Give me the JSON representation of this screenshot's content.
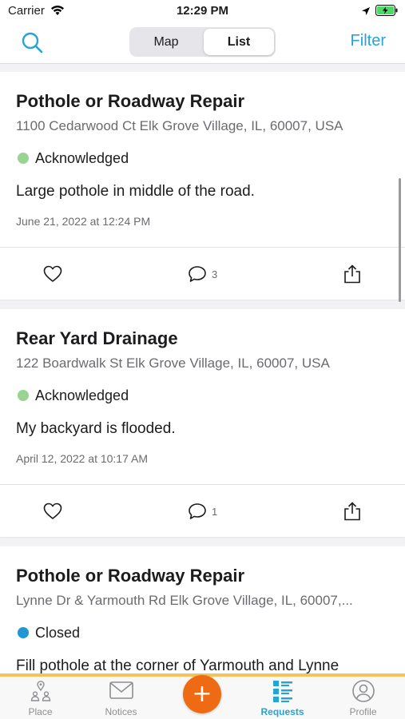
{
  "status_bar": {
    "carrier": "Carrier",
    "time": "12:29 PM"
  },
  "nav": {
    "segments": {
      "map": "Map",
      "list": "List"
    },
    "selected_segment": "List",
    "filter_label": "Filter",
    "accent_color": "#27a3d4"
  },
  "requests": [
    {
      "title": "Pothole or Roadway Repair",
      "address": "1100 Cedarwood Ct Elk Grove Village, IL, 60007, USA",
      "status": "Acknowledged",
      "status_color": "#99d493",
      "description": "Large pothole in middle of the road.",
      "date": "June 21, 2022 at 12:24 PM",
      "comment_count": "3"
    },
    {
      "title": "Rear Yard Drainage",
      "address": "122 Boardwalk St Elk Grove Village, IL, 60007, USA",
      "status": "Acknowledged",
      "status_color": "#99d493",
      "description": "My backyard is flooded.",
      "date": "April 12, 2022 at 10:17 AM",
      "comment_count": "1"
    },
    {
      "title": "Pothole or Roadway Repair",
      "address": "Lynne Dr & Yarmouth Rd Elk Grove Village, IL, 60007,...",
      "status": "Closed",
      "status_color": "#1e97d4",
      "description": "Fill pothole at the corner of Yarmouth and Lynne",
      "date": "",
      "comment_count": ""
    }
  ],
  "tab_bar": {
    "tabs": [
      {
        "label": "Place",
        "icon": "place-icon"
      },
      {
        "label": "Notices",
        "icon": "mail-icon"
      },
      {
        "label": "Requests",
        "icon": "list-icon"
      },
      {
        "label": "Profile",
        "icon": "profile-icon"
      }
    ],
    "active_tab": "Requests",
    "add_button_label": "+",
    "add_button_color": "#ef6b13"
  }
}
